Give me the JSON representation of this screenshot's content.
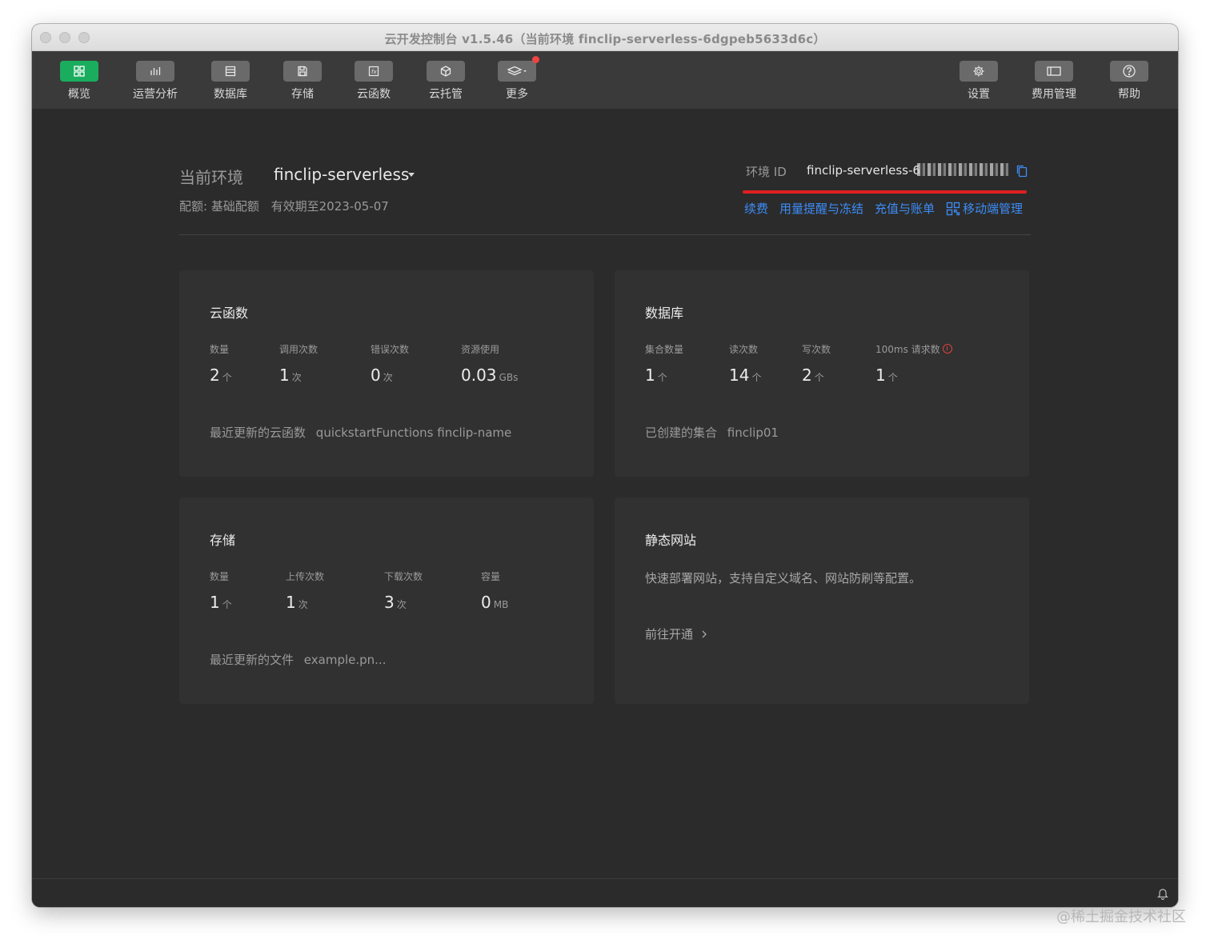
{
  "window": {
    "title": "云开发控制台 v1.5.46（当前环境 finclip-serverless-6dgpeb5633d6c）"
  },
  "toolbar": {
    "items": [
      {
        "label": "概览",
        "icon": "grid-icon"
      },
      {
        "label": "运营分析",
        "icon": "bar-chart-icon"
      },
      {
        "label": "数据库",
        "icon": "database-icon"
      },
      {
        "label": "存储",
        "icon": "save-icon"
      },
      {
        "label": "云函数",
        "icon": "function-icon"
      },
      {
        "label": "云托管",
        "icon": "cube-icon"
      },
      {
        "label": "更多",
        "icon": "layers-icon"
      }
    ],
    "right_items": [
      {
        "label": "设置",
        "icon": "gear-icon"
      },
      {
        "label": "费用管理",
        "icon": "wallet-icon"
      },
      {
        "label": "帮助",
        "icon": "help-icon"
      }
    ]
  },
  "env": {
    "label": "当前环境",
    "name": "finclip-serverless",
    "quota": "配额: 基础配额",
    "valid_until": "有效期至2023-05-07",
    "id_label": "环境 ID",
    "id_value": "finclip-serverless-6"
  },
  "links": {
    "renew": "续费",
    "usage_alert": "用量提醒与冻结",
    "recharge": "充值与账单",
    "mobile": "移动端管理"
  },
  "cards": {
    "functions": {
      "title": "云函数",
      "stats": [
        {
          "label": "数量",
          "value": "2",
          "unit": "个"
        },
        {
          "label": "调用次数",
          "value": "1",
          "unit": "次"
        },
        {
          "label": "错误次数",
          "value": "0",
          "unit": "次"
        },
        {
          "label": "资源使用",
          "value": "0.03",
          "unit": "GBs"
        }
      ],
      "recent_label": "最近更新的云函数",
      "recent_items": "quickstartFunctions finclip-name"
    },
    "database": {
      "title": "数据库",
      "stats": [
        {
          "label": "集合数量",
          "value": "1",
          "unit": "个"
        },
        {
          "label": "读次数",
          "value": "14",
          "unit": "个"
        },
        {
          "label": "写次数",
          "value": "2",
          "unit": "个"
        },
        {
          "label": "100ms 请求数",
          "value": "1",
          "unit": "个"
        }
      ],
      "recent_label": "已创建的集合",
      "recent_items": "finclip01"
    },
    "storage": {
      "title": "存储",
      "stats": [
        {
          "label": "数量",
          "value": "1",
          "unit": "个"
        },
        {
          "label": "上传次数",
          "value": "1",
          "unit": "次"
        },
        {
          "label": "下载次数",
          "value": "3",
          "unit": "次"
        },
        {
          "label": "容量",
          "value": "0",
          "unit": "MB"
        }
      ],
      "recent_label": "最近更新的文件",
      "recent_items": "example.pn..."
    },
    "static_site": {
      "title": "静态网站",
      "desc": "快速部署网站，支持自定义域名、网站防刷等配置。",
      "action": "前往开通"
    }
  },
  "watermark": "@稀土掘金技术社区",
  "colors": {
    "accent_green": "#1aad5e",
    "link_blue": "#3d8cf5",
    "alert_red": "#e02020"
  }
}
